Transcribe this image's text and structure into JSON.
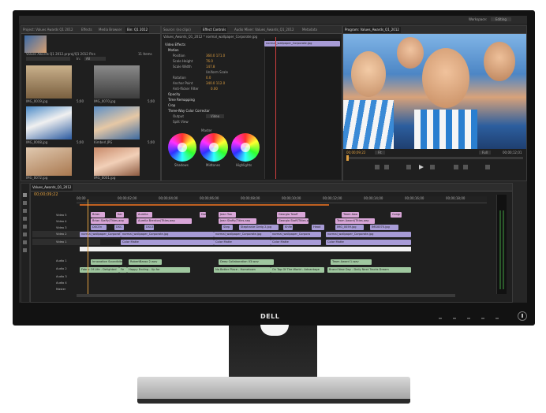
{
  "monitor": {
    "brand": "DELL"
  },
  "workspace": {
    "label": "Workspace:",
    "value": "Editing"
  },
  "project_panel": {
    "tabs": [
      "Project: Values Awards Q1 2012",
      "Effects",
      "Media Browser",
      "Bin: Q1 2012"
    ],
    "bin_name": "Values Awards Q1 2012.prproj/Q1 2012 Pics",
    "item_count": "11 Items",
    "filter_label": "In:",
    "filter_value": "All",
    "items": [
      {
        "name": "IMG_0019.jpg",
        "dur": "5;00"
      },
      {
        "name": "IMG_0070.jpg",
        "dur": "5;00"
      },
      {
        "name": "IMG_0008.jpg",
        "dur": "5;00"
      },
      {
        "name": "Kimberl.JPG",
        "dur": "5;00"
      },
      {
        "name": "IMG_0072.jpg",
        "dur": "5;00"
      },
      {
        "name": "IMG_0001.jpg",
        "dur": "5;00"
      }
    ]
  },
  "effect_controls": {
    "tabs": [
      "Source: (no clips)",
      "Effect Controls",
      "Audio Mixer: Values_Awards_Q1_2012",
      "Metadata"
    ],
    "sequence": "Values_Awards_Q1_2012 * normal_wallpaper_Corporate.jpg",
    "clip": "normal_wallpaper_Corporate.jpg",
    "section": "Video Effects",
    "rows": [
      {
        "name": "Motion",
        "value": ""
      },
      {
        "name": "Position",
        "value": "360.0   171.0"
      },
      {
        "name": "Scale Height",
        "value": "76.0"
      },
      {
        "name": "Scale Width",
        "value": "147.8"
      },
      {
        "name": "Uniform Scale",
        "value": ""
      },
      {
        "name": "Rotation",
        "value": "0.0"
      },
      {
        "name": "Anchor Point",
        "value": "340.0   112.0"
      },
      {
        "name": "Anti-flicker Filter",
        "value": "0.00"
      },
      {
        "name": "Opacity",
        "value": ""
      },
      {
        "name": "Time Remapping",
        "value": ""
      },
      {
        "name": "Crop",
        "value": ""
      },
      {
        "name": "Three-Way Color Corrector",
        "value": ""
      },
      {
        "name": "Output",
        "value": "Video"
      },
      {
        "name": "Split View",
        "value": ""
      }
    ],
    "master_label": "Master",
    "wheels": [
      "Shadows",
      "Midtones",
      "Highlights"
    ]
  },
  "program_monitor": {
    "tab": "Program: Values_Awards_Q1_2012",
    "timecode_left": "00;00;09;22",
    "fit": "Fit",
    "full": "Full",
    "timecode_right": "00;00;12;01"
  },
  "timeline": {
    "tab": "Values_Awards_Q1_2012",
    "timecode": "00;00;09;22",
    "ruler": [
      "00;00",
      "00;00;02;00",
      "00;00;04;00",
      "00;00;06;00",
      "00;00;08;00",
      "00;00;10;00",
      "00;00;12;00",
      "00;00;14;00",
      "00;00;16;00",
      "00;00;18;00"
    ],
    "tracks": [
      "Video 5",
      "Video 4",
      "Video 3",
      "Video 2",
      "Video 1",
      "Audio 1",
      "Audio 2",
      "Audio 3",
      "Audio 4",
      "Master"
    ],
    "clips": {
      "v5": [
        "Brian",
        "Kar",
        "Aurelia",
        "Dot",
        "Jean Too",
        "Georgia Twaff",
        "Team Awa",
        "Congr"
      ],
      "v4": [
        "Brian Staffy(Titles.aep",
        "Aurelia Brenton(Titles.aep",
        "Jean Staffy(Titles.aep",
        "Georgia Staff(Titles.aep",
        "Team Award(Titles.aep"
      ],
      "v3": [
        "DSCEn",
        "DSC",
        "DSCE",
        "Step",
        "Stephanie Greig 2.jpg",
        "Khlfe",
        "Head",
        "IMG_0059.jpg",
        "IMG0070.jpg"
      ],
      "v2": [
        "normal_wallpaper_Corporat",
        "normal_wallpaper_Corporate.jpg",
        "normal_wallpaper_Corporate.jpg",
        "normal_wallpaper_Corpora",
        "normal_wallpaper_Corporate.jpg"
      ],
      "v1": [
        "Color Matte",
        "Color Matte",
        "Color Matte",
        "Color Matte"
      ],
      "a1": [
        "Innovation Soundbite 1",
        "RobertBasso 2.wav",
        "Deep Collaboration 03.wav",
        "Team Award 1.wav"
      ],
      "a2": [
        "Fabric Of Life - Delighted",
        "Fe",
        "Happy Ending - Up for",
        "No Better Place - Hometown",
        "On Top Of The World - Advantage",
        "Brand New Day - Daily Next Tracks Dream"
      ]
    }
  }
}
